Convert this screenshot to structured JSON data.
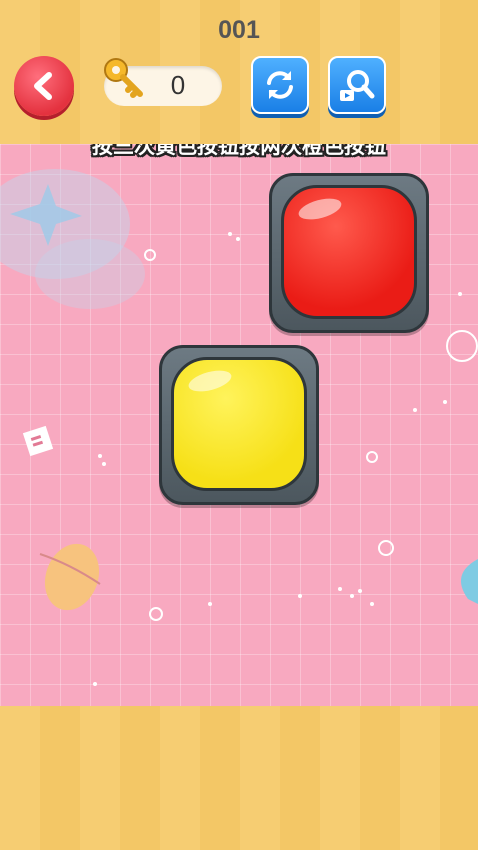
{
  "header": {
    "level": "001",
    "key_count": "0",
    "back_icon": "chevron-left-icon",
    "refresh_icon": "refresh-icon",
    "hint_icon": "magnifier-video-icon"
  },
  "instruction": "按三次黄色按钮按两次橙色按钮",
  "buttons": [
    {
      "id": "red",
      "color": "#ea1c16"
    },
    {
      "id": "yellow",
      "color": "#f6e017"
    }
  ],
  "colors": {
    "stripe": "#f6cd72",
    "play_area": "#f8a9c0",
    "back_button": "#e4323f",
    "tool_button": "#1a7fe6"
  }
}
